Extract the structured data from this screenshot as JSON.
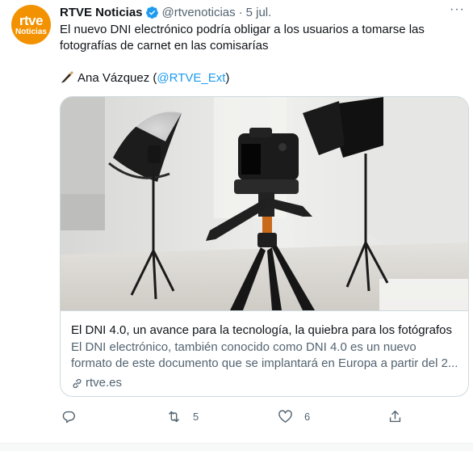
{
  "account": {
    "avatar_line1": "rtve",
    "avatar_line2": "Noticias",
    "name": "RTVE Noticias",
    "handle": "@rtvenoticias",
    "separator": "·",
    "date": "5 jul.",
    "more_label": "···"
  },
  "tweet": {
    "text": "El nuevo DNI electrónico podría obligar a los usuarios a tomarse las fotografías de carnet en las comisarías",
    "credit_name": "Ana Vázquez (",
    "credit_mention": "@RTVE_Ext",
    "credit_close": ")"
  },
  "card": {
    "title": "El DNI 4.0, un avance para la tecnología, la quiebra para los fotógrafos",
    "desc_line1": "El DNI electrónico, también conocido como DNI 4.0 es un nuevo",
    "desc_line2": "formato de este documento que se implantará en Europa a partir del 2...",
    "domain": "rtve.es"
  },
  "actions": {
    "reply_count": "",
    "retweet_count": "5",
    "like_count": "6"
  },
  "colors": {
    "brand": "#f39200",
    "accent": "#1d9bf0",
    "secondary_text": "#536471"
  },
  "icons": [
    "verified-badge-icon",
    "more-icon",
    "pen-icon",
    "link-icon",
    "reply-icon",
    "retweet-icon",
    "like-icon",
    "share-icon"
  ]
}
